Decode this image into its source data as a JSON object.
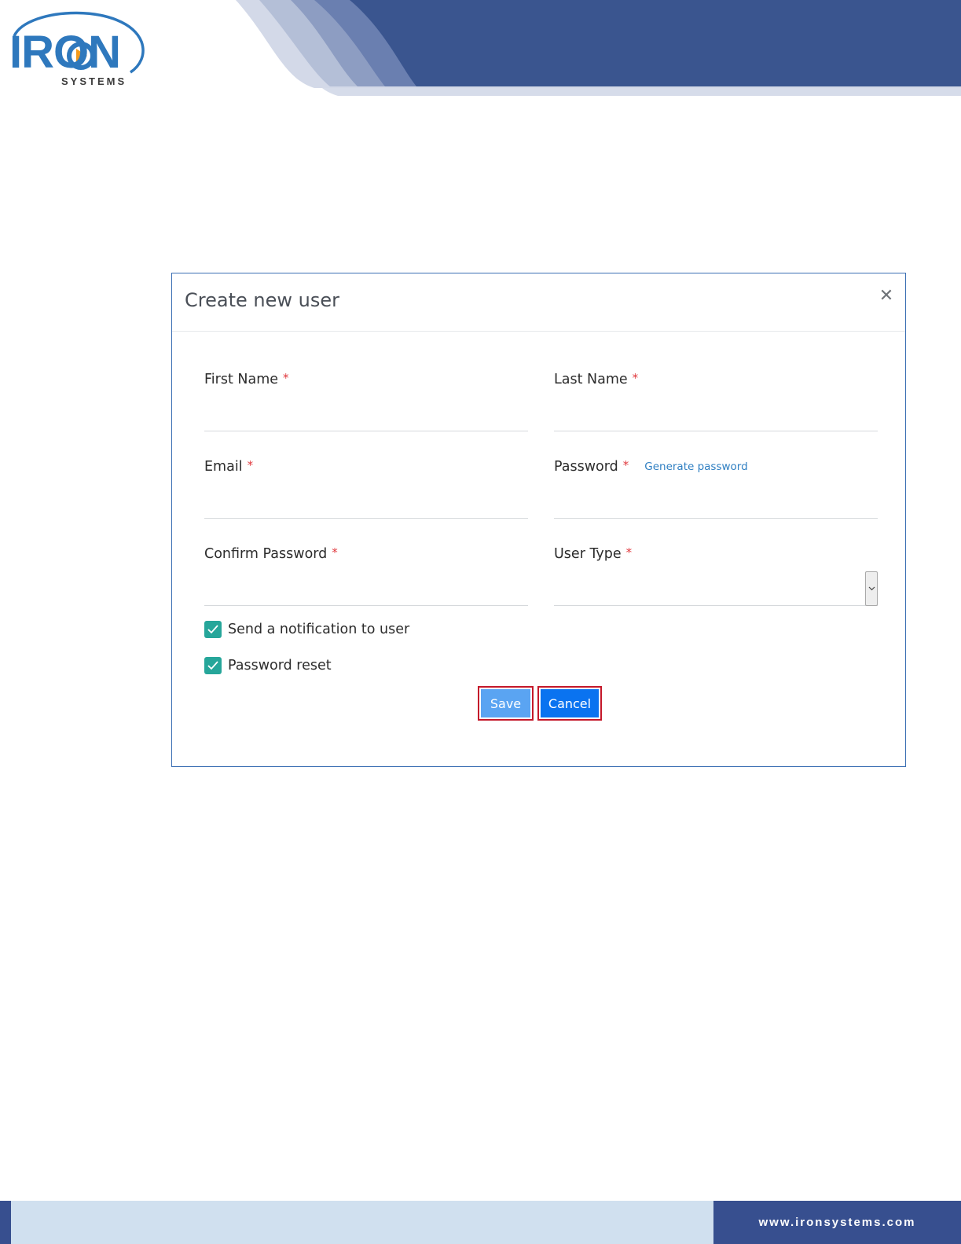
{
  "brand": {
    "logo_text": "IRON",
    "logo_subtext": "SYSTEMS",
    "colors": {
      "primary_blue": "#2e78bd",
      "header_navy": "#3a558f",
      "accent_orange": "#f29a1c"
    }
  },
  "dialog": {
    "title": "Create new user",
    "close_icon": "close-icon",
    "fields": {
      "first_name": {
        "label": "First Name",
        "required_mark": "*",
        "value": ""
      },
      "last_name": {
        "label": "Last Name",
        "required_mark": "*",
        "value": ""
      },
      "email": {
        "label": "Email",
        "required_mark": "*",
        "value": ""
      },
      "password": {
        "label": "Password",
        "required_mark": "*",
        "value": "",
        "generate_link": "Generate password"
      },
      "confirm_password": {
        "label": "Confirm Password",
        "required_mark": "*",
        "value": ""
      },
      "user_type": {
        "label": "User Type",
        "required_mark": "*",
        "selected": ""
      }
    },
    "checkboxes": {
      "send_notification": {
        "label": "Send a notification to user",
        "checked": true
      },
      "password_reset": {
        "label": "Password reset",
        "checked": true
      }
    },
    "buttons": {
      "save": "Save",
      "cancel": "Cancel"
    },
    "colors": {
      "checkbox": "#26a69a",
      "save_button": "#5aa4f2",
      "cancel_button": "#0a73f0",
      "button_border": "#c4182a",
      "required": "#e0393e",
      "link": "#2f7fc2"
    }
  },
  "footer": {
    "url": "www.ironsystems.com"
  }
}
